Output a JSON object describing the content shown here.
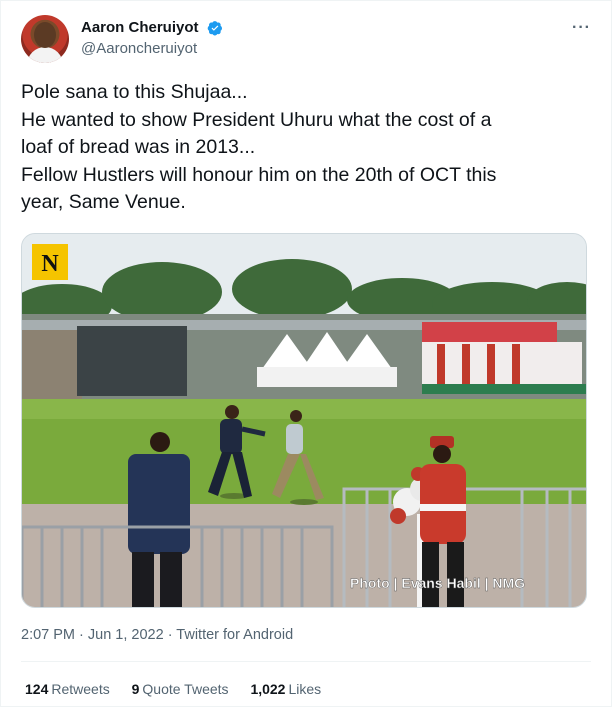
{
  "author": {
    "display_name": "Aaron Cheruiyot",
    "handle": "@Aaroncheruiyot",
    "verified": true
  },
  "menu": {
    "more_label": "···"
  },
  "tweet": {
    "lines": [
      "Pole sana to this Shujaa...",
      "He wanted to show President Uhuru what the cost of a",
      "loaf of bread was in 2013...",
      "Fellow Hustlers will honour him on the 20th of OCT this",
      "year, Same Venue."
    ],
    "timestamp": "2:07 PM · Jun 1, 2022 · Twitter for Android"
  },
  "photo": {
    "logo_letter": "N",
    "credit": "Photo | Evans Habil | NMG"
  },
  "stats": {
    "retweets_count": "124",
    "retweets_label": "Retweets",
    "quotes_count": "9",
    "quotes_label": "Quote Tweets",
    "likes_count": "1,022",
    "likes_label": "Likes"
  },
  "colors": {
    "verified": "#1d9bf0",
    "secondary_text": "#536471",
    "logo_bg": "#f5c400"
  }
}
